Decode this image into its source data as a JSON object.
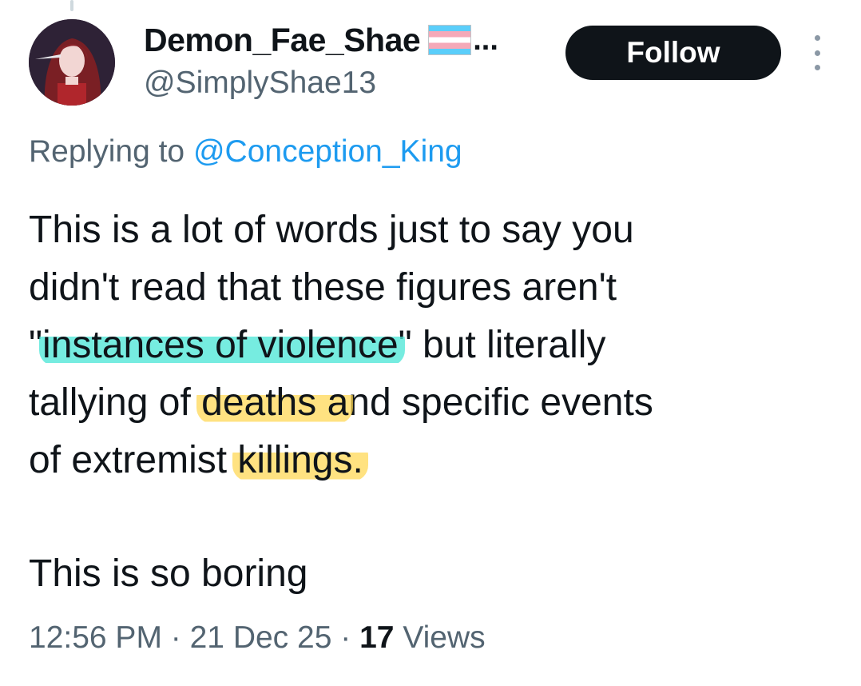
{
  "author": {
    "display_name": "Demon_Fae_Shae",
    "name_truncation": "...",
    "flag_icon": "transgender-flag",
    "handle": "@SimplyShae13"
  },
  "actions": {
    "follow_label": "Follow",
    "more_icon": "vertical-ellipsis"
  },
  "reply": {
    "prefix": "Replying to",
    "target": "@Conception_King"
  },
  "tweet": {
    "line1": "This is a lot of words just to say you",
    "line2": "didn't read that these figures aren't",
    "line3_quote_open": "\"",
    "line3_highlight": "instances of violence",
    "line3_rest": "\" but literally",
    "line4_start": "tallying of ",
    "line4_highlight": "deaths a",
    "line4_rest": "nd specific events",
    "line5_start": "of extremist ",
    "line5_highlight": "killings.",
    "closing": "This is so boring",
    "highlight_colors": {
      "cyan": "#48e6d6",
      "yellow": "#ffd750"
    }
  },
  "meta": {
    "time": "12:56 PM",
    "separator": " · ",
    "date": "21 Dec 25",
    "views_count": "17",
    "views_label": "Views"
  },
  "colors": {
    "text": "#0f1419",
    "secondary": "#536471",
    "link": "#1d9bf0",
    "button_bg": "#0f1419"
  }
}
